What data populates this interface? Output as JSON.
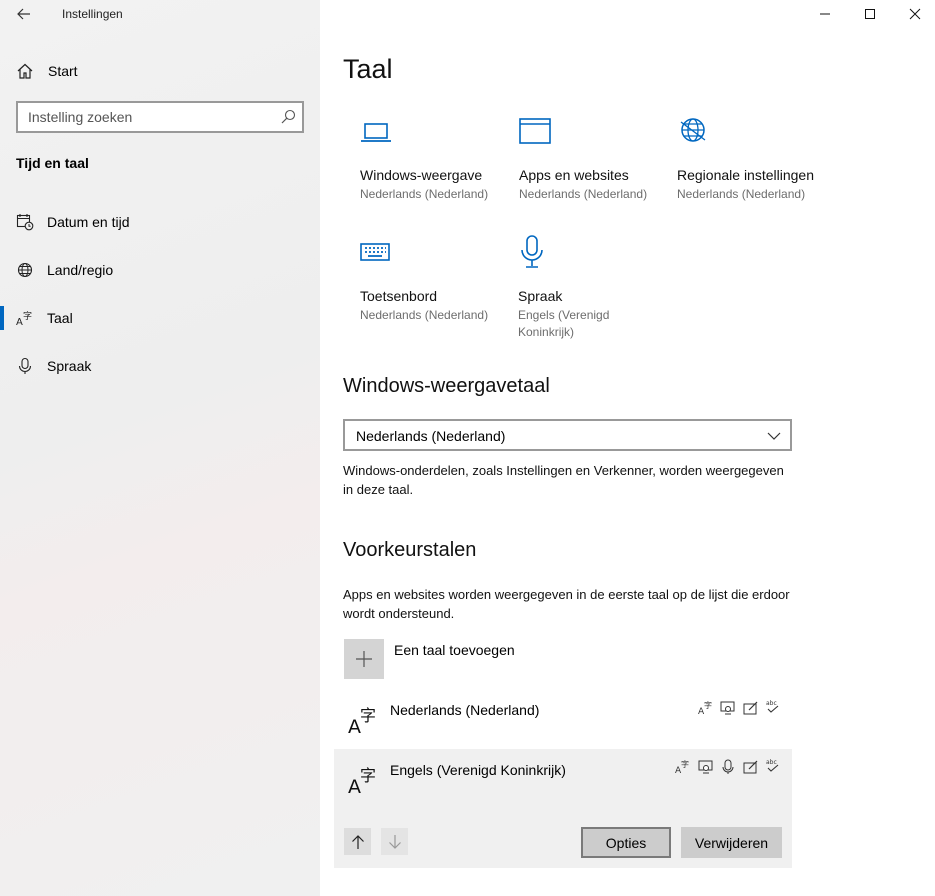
{
  "window": {
    "title": "Instellingen"
  },
  "sidebar": {
    "home_label": "Start",
    "search_placeholder": "Instelling zoeken",
    "section_title": "Tijd en taal",
    "items": [
      {
        "label": "Datum en tijd",
        "icon": "calendar-clock-icon"
      },
      {
        "label": "Land/regio",
        "icon": "globe-icon"
      },
      {
        "label": "Taal",
        "icon": "language-icon",
        "active": true
      },
      {
        "label": "Spraak",
        "icon": "microphone-icon"
      }
    ]
  },
  "main": {
    "title": "Taal",
    "tiles": [
      {
        "name": "Windows-weergave",
        "sub": "Nederlands (Nederland)",
        "icon": "laptop-icon"
      },
      {
        "name": "Apps en websites",
        "sub": "Nederlands (Nederland)",
        "icon": "window-icon"
      },
      {
        "name": "Regionale instellingen",
        "sub": "Nederlands (Nederland)",
        "icon": "globe-icon"
      },
      {
        "name": "Toetsenbord",
        "sub": "Nederlands (Nederland)",
        "icon": "keyboard-icon"
      },
      {
        "name": "Spraak",
        "sub": "Engels (Verenigd Koninkrijk)",
        "icon": "microphone-icon"
      }
    ],
    "display_language": {
      "heading": "Windows-weergavetaal",
      "selected": "Nederlands (Nederland)",
      "description": "Windows-onderdelen, zoals Instellingen en Verkenner, worden weergegeven in deze taal."
    },
    "preferred": {
      "heading": "Voorkeurstalen",
      "description": "Apps en websites worden weergegeven in de eerste taal op de lijst die erdoor wordt ondersteund.",
      "add_label": "Een taal toevoegen",
      "languages": [
        {
          "name": "Nederlands (Nederland)"
        },
        {
          "name": "Engels (Verenigd Koninkrijk)",
          "selected": true
        }
      ],
      "options_label": "Opties",
      "remove_label": "Verwijderen"
    }
  },
  "colors": {
    "accent": "#0067c0",
    "sidebar_bg": "#f0f0f0"
  }
}
